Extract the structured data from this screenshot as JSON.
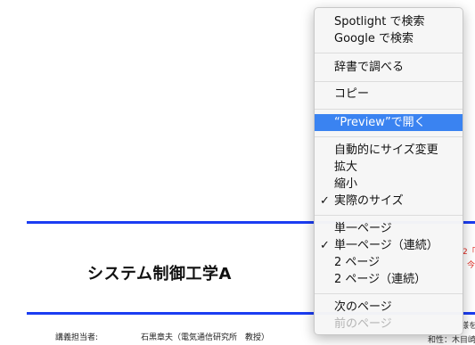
{
  "document": {
    "title": "システム制御工学A",
    "instructor_label": "講義担当者:",
    "instructor_value": "石黒章夫（電気通信研究所　教授）",
    "edge_red_1": "2「",
    "edge_red_2": "今",
    "edge_dark_1": "様を",
    "edge_dark_2": "和性：木目崎"
  },
  "menu": {
    "items": [
      {
        "label": "Spotlight で検索"
      },
      {
        "label": "Google で検索"
      },
      {
        "label": "辞書で調べる"
      },
      {
        "label": "コピー"
      },
      {
        "label": "“Preview”で開く"
      },
      {
        "label": "自動的にサイズ変更"
      },
      {
        "label": "拡大"
      },
      {
        "label": "縮小"
      },
      {
        "label": "実際のサイズ"
      },
      {
        "label": "単一ページ"
      },
      {
        "label": "単一ページ（連続）"
      },
      {
        "label": "2 ページ"
      },
      {
        "label": "2 ページ（連続）"
      },
      {
        "label": "次のページ"
      },
      {
        "label": "前のページ"
      }
    ],
    "check_symbol": "✓"
  }
}
